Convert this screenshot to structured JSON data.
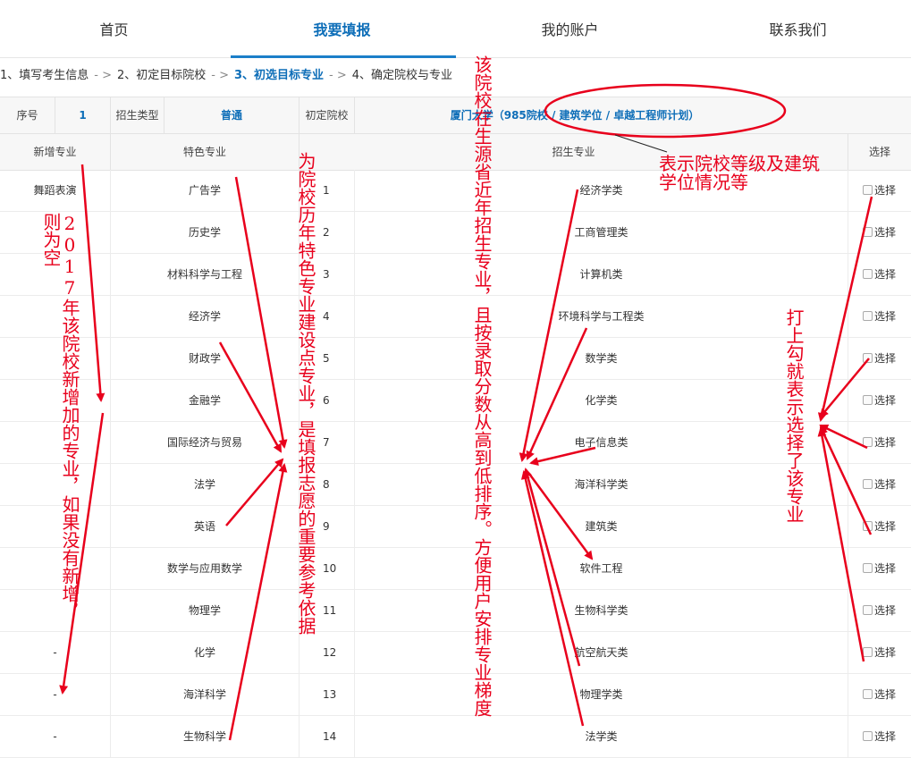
{
  "nav": {
    "items": [
      "首页",
      "我要填报",
      "我的账户",
      "联系我们"
    ],
    "active_index": 1
  },
  "steps": {
    "s1": "1、填写考生信息",
    "s2": "2、初定目标院校",
    "s3": "3、初选目标专业",
    "s4": "4、确定院校与专业",
    "sep": "- >"
  },
  "info": {
    "seq_label": "序号",
    "seq_value": "1",
    "type_label": "招生类型",
    "type_value": "普通",
    "school_label": "初定院校",
    "school_value": "厦门大学（985院校 / 建筑学位 / 卓越工程师计划）"
  },
  "table": {
    "headers": {
      "new": "新增专业",
      "featured": "特色专业",
      "major": "招生专业",
      "select": "选择"
    },
    "select_label": "选择",
    "rows": [
      {
        "new": "舞蹈表演",
        "featured": "广告学",
        "num": "1",
        "major": "经济学类"
      },
      {
        "new": "",
        "featured": "历史学",
        "num": "2",
        "major": "工商管理类"
      },
      {
        "new": "",
        "featured": "材料科学与工程",
        "num": "3",
        "major": "计算机类"
      },
      {
        "new": "",
        "featured": "经济学",
        "num": "4",
        "major": "环境科学与工程类"
      },
      {
        "new": "",
        "featured": "财政学",
        "num": "5",
        "major": "数学类"
      },
      {
        "new": "",
        "featured": "金融学",
        "num": "6",
        "major": "化学类"
      },
      {
        "new": "",
        "featured": "国际经济与贸易",
        "num": "7",
        "major": "电子信息类"
      },
      {
        "new": "",
        "featured": "法学",
        "num": "8",
        "major": "海洋科学类"
      },
      {
        "new": "",
        "featured": "英语",
        "num": "9",
        "major": "建筑类"
      },
      {
        "new": "",
        "featured": "数学与应用数学",
        "num": "10",
        "major": "软件工程"
      },
      {
        "new": "",
        "featured": "物理学",
        "num": "11",
        "major": "生物科学类"
      },
      {
        "new": "-",
        "featured": "化学",
        "num": "12",
        "major": "航空航天类"
      },
      {
        "new": "-",
        "featured": "海洋科学",
        "num": "13",
        "major": "物理学类"
      },
      {
        "new": "-",
        "featured": "生物科学",
        "num": "14",
        "major": "法学类"
      }
    ]
  },
  "annotations": {
    "new_major_note": "2017年该院校新增加的专业，如果没有新增，则为空",
    "featured_note": "为院校历年特色专业建设点专业，是填报志愿的重要参考依据",
    "major_note": "该院校在生源省近年招生专业，且按录取分数从高到低排序。方便用户安排专业梯度",
    "level_note_1": "表示院校等级及建筑",
    "level_note_2": "学位情况等",
    "select_note": "打上勾就表示选择了该专业",
    "color": "#e8001c"
  }
}
